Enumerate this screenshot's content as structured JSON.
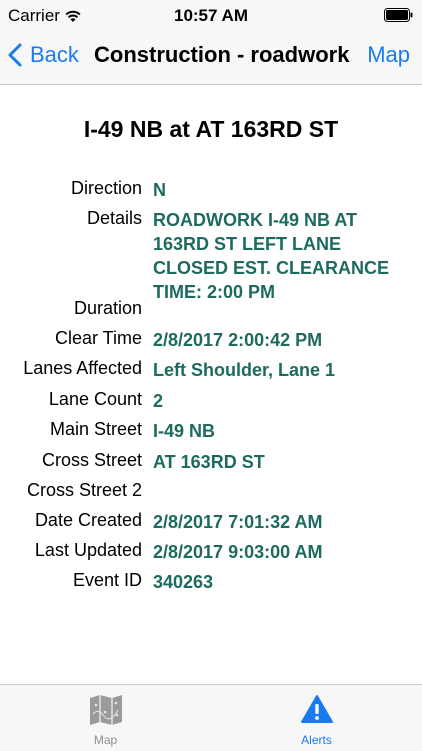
{
  "status_bar": {
    "carrier": "Carrier",
    "time": "10:57 AM",
    "icons": [
      "wifi-icon",
      "battery-icon"
    ]
  },
  "nav": {
    "back_label": "Back",
    "title": "Construction - roadwork",
    "map_label": "Map",
    "accent_color": "#1a7bf0"
  },
  "event": {
    "headline": "I-49 NB at AT 163RD ST",
    "value_color": "#1d6b5e",
    "fields": [
      {
        "label": "Direction",
        "value": "N"
      },
      {
        "label": "Details",
        "value": "ROADWORK I-49 NB AT 163RD ST LEFT LANE CLOSED EST. CLEARANCE TIME: 2:00 PM"
      },
      {
        "label": "Duration",
        "value": ""
      },
      {
        "label": "Clear Time",
        "value": "2/8/2017 2:00:42 PM"
      },
      {
        "label": "Lanes Affected",
        "value": "Left Shoulder, Lane 1"
      },
      {
        "label": "Lane Count",
        "value": "2"
      },
      {
        "label": "Main Street",
        "value": "I-49 NB"
      },
      {
        "label": "Cross Street",
        "value": "AT 163RD ST"
      },
      {
        "label": "Cross Street 2",
        "value": ""
      },
      {
        "label": "Date Created",
        "value": "2/8/2017 7:01:32 AM"
      },
      {
        "label": "Last Updated",
        "value": "2/8/2017 9:03:00 AM"
      },
      {
        "label": "Event ID",
        "value": "340263"
      }
    ]
  },
  "tabs": [
    {
      "label": "Map",
      "icon": "map-icon",
      "active": false
    },
    {
      "label": "Alerts",
      "icon": "alert-icon",
      "active": true
    }
  ]
}
